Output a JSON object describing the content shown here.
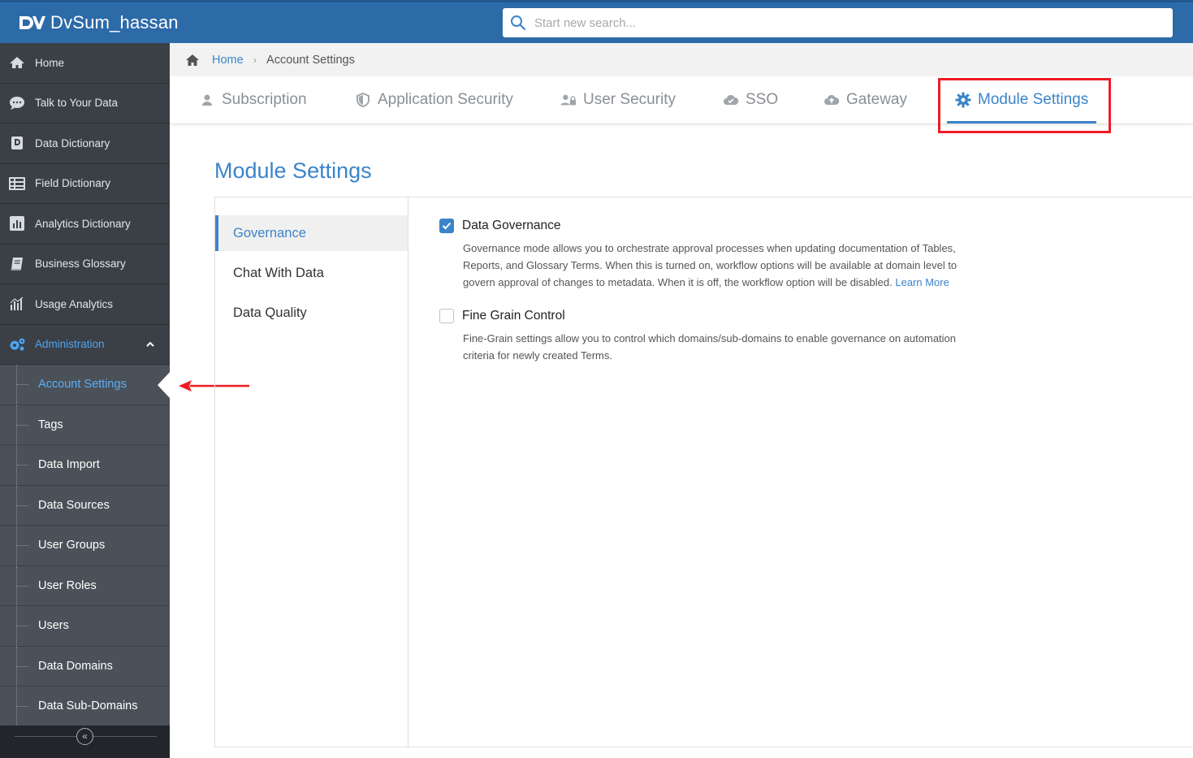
{
  "header": {
    "app_name": "DvSum_hassan",
    "search_placeholder": "Start new search..."
  },
  "sidebar": {
    "items": [
      {
        "label": "Home",
        "icon": "home-icon"
      },
      {
        "label": "Talk to Your Data",
        "icon": "chat-icon"
      },
      {
        "label": "Data Dictionary",
        "icon": "dictionary-icon"
      },
      {
        "label": "Field Dictionary",
        "icon": "table-icon"
      },
      {
        "label": "Analytics Dictionary",
        "icon": "analytics-icon"
      },
      {
        "label": "Business Glossary",
        "icon": "book-icon"
      },
      {
        "label": "Usage Analytics",
        "icon": "bar-chart-icon"
      },
      {
        "label": "Administration",
        "icon": "gears-icon"
      }
    ],
    "admin_subitems": [
      "Account Settings",
      "Tags",
      "Data Import",
      "Data Sources",
      "User Groups",
      "User Roles",
      "Users",
      "Data Domains",
      "Data Sub-Domains"
    ],
    "active_subitem": "Account Settings"
  },
  "breadcrumb": {
    "home": "Home",
    "current": "Account Settings"
  },
  "tabs": [
    {
      "label": "Subscription",
      "icon": "user-icon"
    },
    {
      "label": "Application Security",
      "icon": "shield-icon"
    },
    {
      "label": "User Security",
      "icon": "user-lock-icon"
    },
    {
      "label": "SSO",
      "icon": "cloud-icon"
    },
    {
      "label": "Gateway",
      "icon": "cloud-upload-icon"
    },
    {
      "label": "Module Settings",
      "icon": "gear-icon"
    }
  ],
  "active_tab": "Module Settings",
  "page_title": "Module Settings",
  "left_nav": [
    "Governance",
    "Chat With Data",
    "Data Quality"
  ],
  "active_left_nav": "Governance",
  "settings": [
    {
      "title": "Data Governance",
      "checked": true,
      "description": "Governance mode allows you to orchestrate approval processes when updating documentation of Tables, Reports, and Glossary Terms. When this is turned on, workflow options will be available at domain level to govern approval of changes to metadata. When it is off, the workflow option will be disabled.",
      "link": "Learn More"
    },
    {
      "title": "Fine Grain Control",
      "checked": false,
      "description": "Fine-Grain settings allow you to control which domains/sub-domains to enable governance on automation criteria for newly created Terms."
    }
  ],
  "colors": {
    "header_bg": "#2d6aa8",
    "sidebar_bg": "#3b4047",
    "submenu_bg": "#4b5158",
    "accent": "#3b84c9",
    "annotation_red": "#ee1c25"
  }
}
